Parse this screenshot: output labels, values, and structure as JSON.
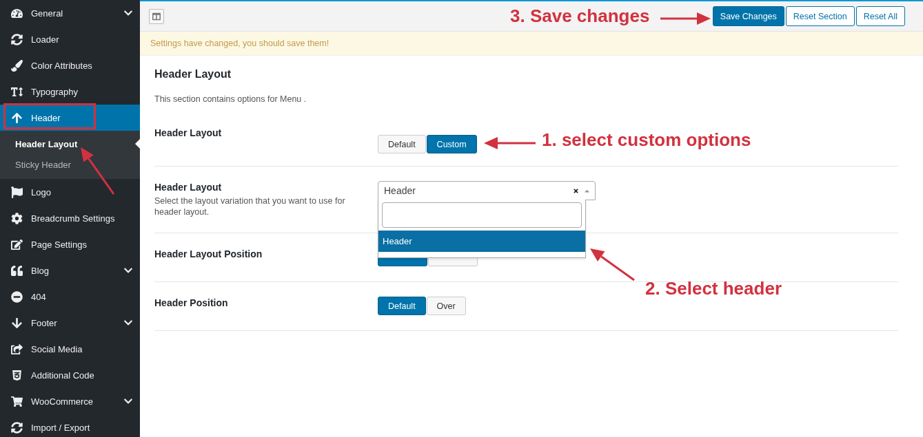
{
  "sidebar": {
    "items": [
      {
        "label": "General",
        "has_submenu": true,
        "selected": false
      },
      {
        "label": "Loader",
        "has_submenu": false,
        "selected": false
      },
      {
        "label": "Color Attributes",
        "has_submenu": false,
        "selected": false
      },
      {
        "label": "Typography",
        "has_submenu": false,
        "selected": false
      },
      {
        "label": "Header",
        "has_submenu": false,
        "selected": true,
        "expanded": true,
        "children": [
          {
            "label": "Header Layout",
            "selected": true
          },
          {
            "label": "Sticky Header",
            "selected": false
          }
        ]
      },
      {
        "label": "Logo",
        "has_submenu": false,
        "selected": false
      },
      {
        "label": "Breadcrumb Settings",
        "has_submenu": false,
        "selected": false
      },
      {
        "label": "Page Settings",
        "has_submenu": false,
        "selected": false
      },
      {
        "label": "Blog",
        "has_submenu": true,
        "selected": false
      },
      {
        "label": "404",
        "has_submenu": false,
        "selected": false
      },
      {
        "label": "Footer",
        "has_submenu": true,
        "selected": false
      },
      {
        "label": "Social Media",
        "has_submenu": false,
        "selected": false
      },
      {
        "label": "Additional Code",
        "has_submenu": false,
        "selected": false
      },
      {
        "label": "WooCommerce",
        "has_submenu": true,
        "selected": false
      },
      {
        "label": "Import / Export",
        "has_submenu": false,
        "selected": false
      }
    ]
  },
  "toolbar": {
    "buttons": [
      {
        "label": "Save Changes",
        "kind": "primary"
      },
      {
        "label": "Reset Section",
        "kind": "secondary"
      },
      {
        "label": "Reset All",
        "kind": "secondary"
      }
    ]
  },
  "notice": "Settings have changed, you should save them!",
  "section": {
    "title": "Header Layout",
    "description": "This section contains options for Menu ."
  },
  "fields": [
    {
      "label": "Header Layout",
      "kind": "button-set",
      "options": [
        {
          "label": "Default",
          "selected": false
        },
        {
          "label": "Custom",
          "selected": true
        }
      ]
    },
    {
      "label": "Header Layout",
      "description": "Select the layout variation that you want to use for header layout.",
      "kind": "select",
      "value": "Header",
      "open": true,
      "options": [
        {
          "label": "Header",
          "selected": true
        }
      ]
    },
    {
      "label": "Header Layout Position",
      "kind": "button-set",
      "options": [
        {
          "selected": true
        },
        {
          "selected": false
        }
      ]
    },
    {
      "label": "Header Position",
      "kind": "button-set",
      "options": [
        {
          "label": "Default",
          "selected": true
        },
        {
          "label": "Over",
          "selected": false
        }
      ]
    }
  ],
  "annotations": [
    {
      "text": "3. Save changes"
    },
    {
      "text": "1. select custom options"
    },
    {
      "text": "2. Select header"
    }
  ]
}
